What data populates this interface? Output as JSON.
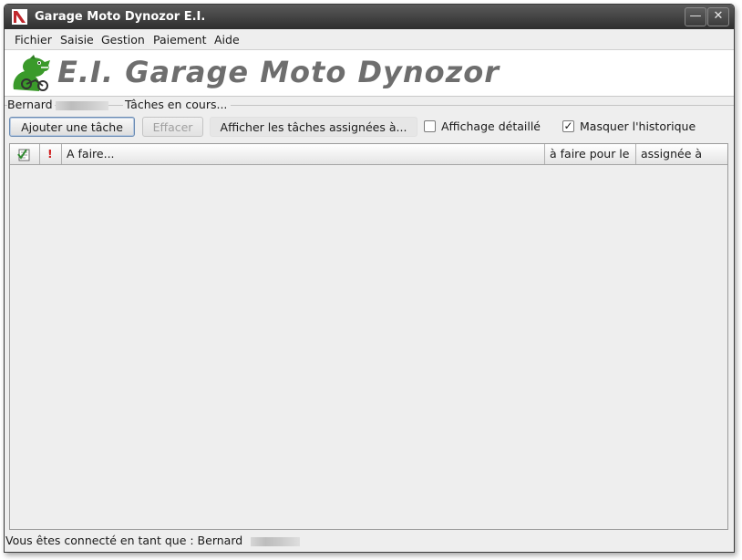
{
  "window": {
    "title": "Garage Moto Dynozor E.I.",
    "minimize_glyph": "—",
    "close_glyph": "✕"
  },
  "menu": [
    "Fichier",
    "Saisie",
    "Gestion",
    "Paiement",
    "Aide"
  ],
  "banner": {
    "title": "E.I. Garage Moto Dynozor"
  },
  "user_panel": {
    "user_name": "Bernard",
    "group_title": "Tâches en cours..."
  },
  "toolbar": {
    "add_task_label": "Ajouter une tâche",
    "erase_label": "Effacer",
    "show_assigned_label": "Afficher les tâches assignées à...",
    "detailed_view_label": "Affichage détaillé",
    "detailed_view_checked": false,
    "hide_history_label": "Masquer l'historique",
    "hide_history_checked": true
  },
  "table": {
    "columns": {
      "status_icon": "check-list-icon",
      "priority": "!",
      "todo": "A faire...",
      "due": "à faire pour le",
      "assigned": "assignée à"
    },
    "rows": []
  },
  "statusbar": {
    "text": "Vous êtes connecté en tant que : Bernard"
  },
  "colors": {
    "titlebar": "#2e2e2e",
    "banner_text": "#6e6e6e",
    "priority_mark": "#d02020",
    "logo_green": "#3a9a2a"
  }
}
